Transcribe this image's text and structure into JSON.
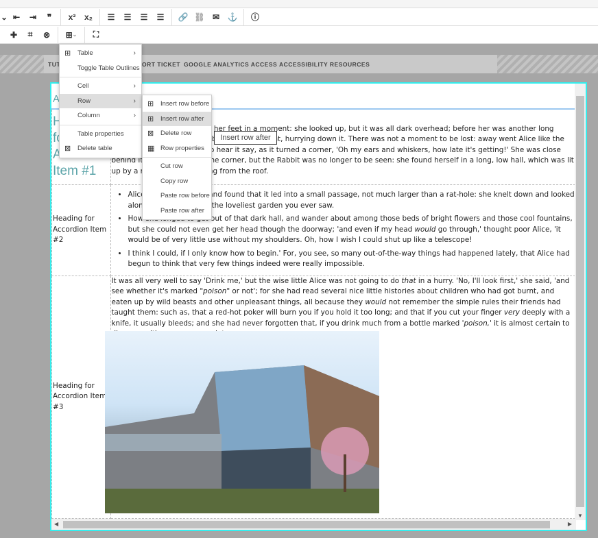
{
  "toolbar": {
    "row1": [
      "chevron-down",
      "outdent",
      "indent",
      "blockquote",
      "superscript",
      "subscript",
      "align-left",
      "align-center",
      "align-right",
      "justify",
      "link",
      "unlink",
      "email",
      "anchor",
      "help"
    ],
    "row2": [
      "puzzle",
      "crop",
      "cells",
      "table",
      "fullscreen"
    ]
  },
  "nav": {
    "links": [
      "TUT",
      "ORT TICKET",
      "GOOGLE ANALYTICS ACCESS",
      "ACCESSIBILITY RESOURCES"
    ]
  },
  "editor": {
    "title": "Ac",
    "rows": [
      {
        "heading": "Heading for Accordion Item #1",
        "text": "Rabbit was jumped up on to her feet in a moment: she looked up, but it was all dark overhead; before her was another long passage, and the White Rabbit was still in sight, hurrying down it. There was not a moment to be lost: away went Alice like the wind, and was just in time to hear it say, as it turned a corner, 'Oh my ears and whiskers, how late it's getting!' She was close behind it when she turned the corner, but the Rabbit was no longer to be seen: she found herself in a long, low hall, which was lit up by a row of lamps hanging from the roof."
      },
      {
        "heading": "Heading for Accordion Item #2",
        "bullets": [
          "Alice opened the door and found that it led into a small passage, not much larger than a rat-hole: she knelt down and looked along the passage into the loveliest garden you ever saw.",
          "How she longed to get out of that dark hall, and wander about among those beds of bright flowers and those cool fountains, but she could not even get her head though the doorway; 'and even if my head ",
          "would",
          " go through,' thought poor Alice, 'it would be of very little use without my shoulders. Oh, how I wish I could shut up like a telescope!",
          "I think I could, if I only know how to begin.' For, you see, so many out-of-the-way things had happened lately, that Alice had begun to think that very few things indeed were really impossible."
        ]
      },
      {
        "heading": "Heading for Accordion Item #3",
        "parts": [
          "It was all very well to say 'Drink me,' but the wise little Alice was not going to do ",
          "that",
          " in a hurry. 'No, I'll look first,' she said, 'and see whether it's marked \"",
          "poison",
          "\" or not'; for she had read several nice little histories about children who had got burnt, and eaten up by wild beasts and other unpleasant things, all because they ",
          "would",
          " not remember the simple rules their friends had taught them: such as, that a red-hot poker will burn you if you hold it too long; and that if you cut your finger ",
          "very",
          " deeply with a knife, it usually bleeds; and she had never forgotten that, if you drink much from a bottle marked '",
          "poison,",
          "' it is almost certain to disagree with you, sooner or later."
        ]
      }
    ]
  },
  "table_menu": {
    "items": [
      "Table",
      "Toggle Table Outlines",
      "Cell",
      "Row",
      "Column",
      "Table properties",
      "Delete table"
    ],
    "highlighted": "Row"
  },
  "row_menu": {
    "items": [
      "Insert row before",
      "Insert row after",
      "Delete row",
      "Row properties",
      "Cut row",
      "Copy row",
      "Paste row before",
      "Paste row after"
    ],
    "highlighted": "Insert row after"
  },
  "tooltip": "Insert row after",
  "colors": {
    "accent": "#5aa3a8",
    "editor_border": "#33eeee",
    "highlight": "#dedede"
  }
}
